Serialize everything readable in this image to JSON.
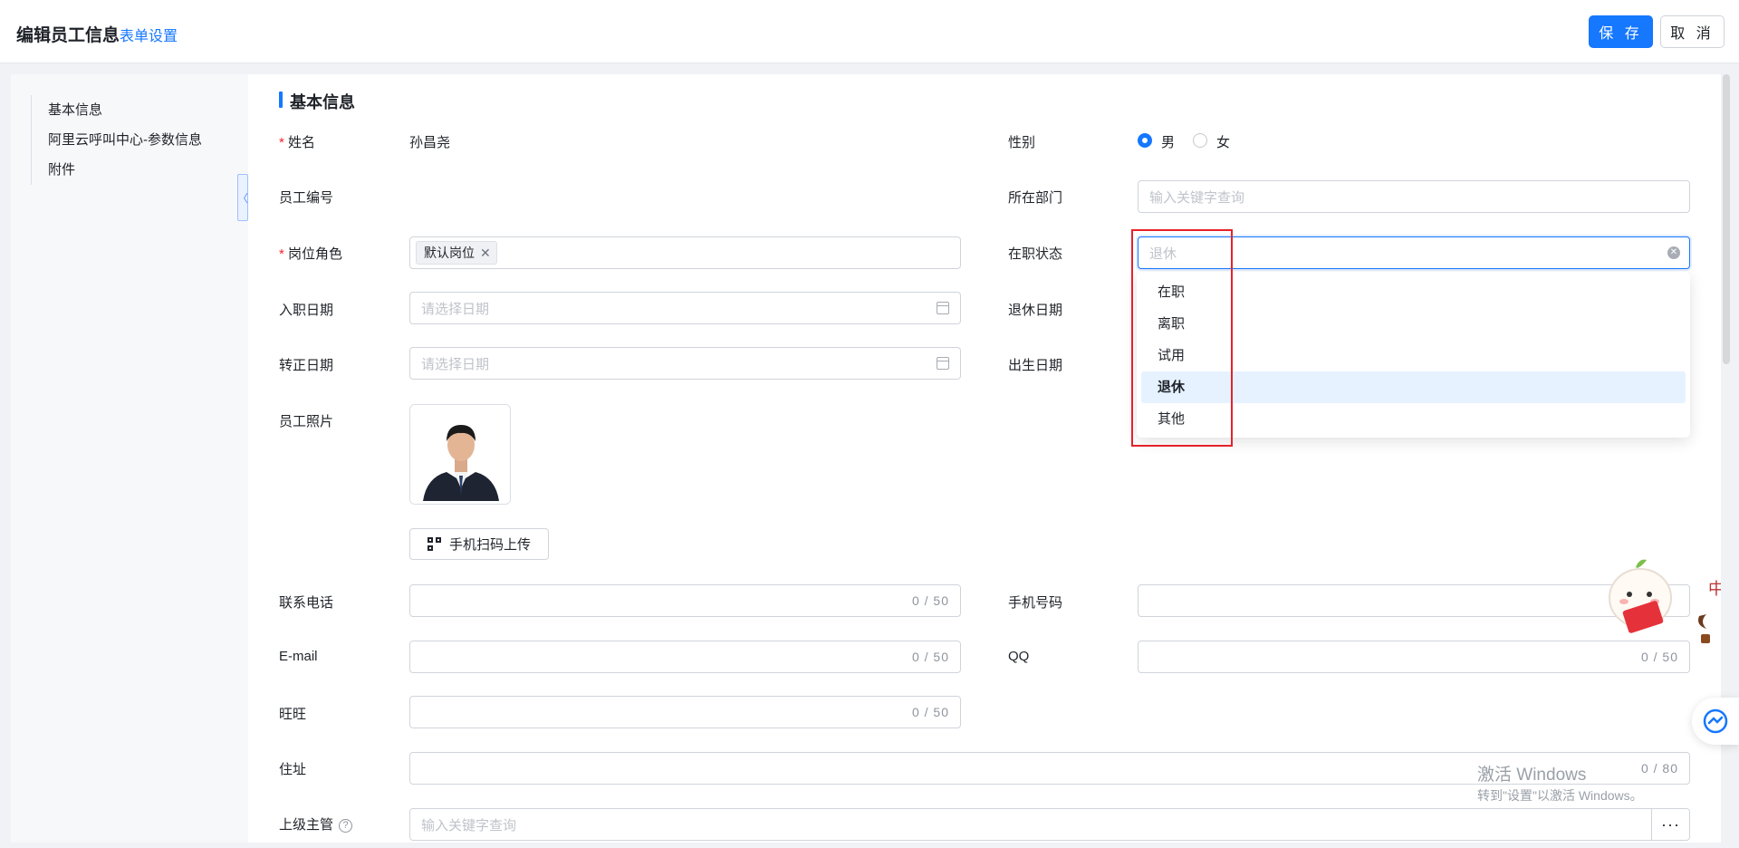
{
  "header": {
    "title": "编辑员工信息",
    "form_settings": "表单设置",
    "save_label": "保 存",
    "cancel_label": "取 消"
  },
  "sidebar": {
    "items": [
      {
        "label": "基本信息"
      },
      {
        "label": "阿里云呼叫中心-参数信息"
      },
      {
        "label": "附件"
      }
    ]
  },
  "section": {
    "title": "基本信息"
  },
  "form": {
    "name": {
      "label": "姓名",
      "value": "孙昌尧"
    },
    "gender": {
      "label": "性别",
      "options": [
        "男",
        "女"
      ],
      "selected": "男"
    },
    "employee_no": {
      "label": "员工编号"
    },
    "department": {
      "label": "所在部门",
      "placeholder": "输入关键字查询"
    },
    "role": {
      "label": "岗位角色",
      "tag": "默认岗位"
    },
    "status": {
      "label": "在职状态",
      "value": "退休"
    },
    "hire_date": {
      "label": "入职日期",
      "placeholder": "请选择日期"
    },
    "retire_date": {
      "label": "退休日期"
    },
    "regular_date": {
      "label": "转正日期",
      "placeholder": "请选择日期"
    },
    "birth_date": {
      "label": "出生日期"
    },
    "photo": {
      "label": "员工照片",
      "upload_label": "手机扫码上传"
    },
    "phone": {
      "label": "联系电话",
      "counter": "0 / 50"
    },
    "mobile": {
      "label": "手机号码"
    },
    "email": {
      "label": "E-mail",
      "counter": "0 / 50"
    },
    "qq": {
      "label": "QQ",
      "counter": "0 / 50"
    },
    "wangwang": {
      "label": "旺旺",
      "counter": "0 / 50"
    },
    "address": {
      "label": "住址",
      "counter": "0 / 80"
    },
    "supervisor": {
      "label": "上级主管",
      "placeholder": "输入关键字查询",
      "more": "···"
    }
  },
  "status_dropdown": {
    "options": [
      "在职",
      "离职",
      "试用",
      "退休",
      "其他"
    ],
    "selected": "退休"
  },
  "overlay": {
    "watermark_title": "激活 Windows",
    "watermark_sub": "转到\"设置\"以激活 Windows。",
    "mascot_char": "中"
  },
  "colors": {
    "accent": "#1677ff",
    "required": "#f5222d",
    "highlight_box": "#e5222b"
  }
}
